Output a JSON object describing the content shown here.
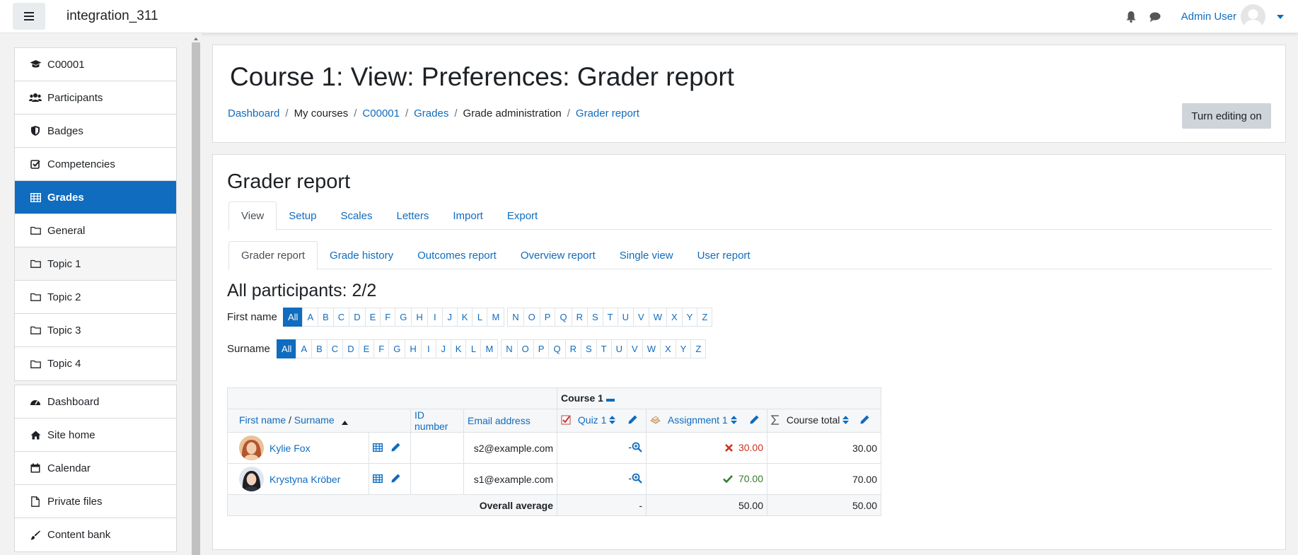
{
  "navbar": {
    "site_name": "integration_311",
    "user_name": "Admin User",
    "icons": [
      "menu-icon",
      "bell-icon",
      "comment-icon",
      "avatar-icon",
      "caret-down-icon"
    ]
  },
  "drawer": {
    "course_items": [
      {
        "label": "C00001",
        "icon": "graduation-cap-icon"
      },
      {
        "label": "Participants",
        "icon": "users-icon"
      },
      {
        "label": "Badges",
        "icon": "shield-icon"
      },
      {
        "label": "Competencies",
        "icon": "check-square-icon"
      },
      {
        "label": "Grades",
        "icon": "table-icon",
        "active": true
      },
      {
        "label": "General",
        "icon": "folder-icon"
      },
      {
        "label": "Topic 1",
        "icon": "folder-icon"
      },
      {
        "label": "Topic 2",
        "icon": "folder-icon"
      },
      {
        "label": "Topic 3",
        "icon": "folder-icon"
      },
      {
        "label": "Topic 4",
        "icon": "folder-icon"
      }
    ],
    "site_items": [
      {
        "label": "Dashboard",
        "icon": "tachometer-icon"
      },
      {
        "label": "Site home",
        "icon": "home-icon"
      },
      {
        "label": "Calendar",
        "icon": "calendar-icon"
      },
      {
        "label": "Private files",
        "icon": "file-icon"
      },
      {
        "label": "Content bank",
        "icon": "paint-brush-icon"
      }
    ]
  },
  "header": {
    "title": "Course 1: View: Preferences: Grader report",
    "breadcrumb": [
      "Dashboard",
      "My courses",
      "C00001",
      "Grades",
      "Grade administration",
      "Grader report"
    ],
    "edit_button": "Turn editing on"
  },
  "main": {
    "title": "Grader report",
    "tabs": [
      "View",
      "Setup",
      "Scales",
      "Letters",
      "Import",
      "Export"
    ],
    "subtabs": [
      "Grader report",
      "Grade history",
      "Outcomes report",
      "Overview report",
      "Single view",
      "User report"
    ],
    "participants_title": "All participants: 2/2",
    "first_name_label": "First name",
    "surname_label": "Surname",
    "all_label": "All",
    "letters": [
      "A",
      "B",
      "C",
      "D",
      "E",
      "F",
      "G",
      "H",
      "I",
      "J",
      "K",
      "L",
      "M",
      "N",
      "O",
      "P",
      "Q",
      "R",
      "S",
      "T",
      "U",
      "V",
      "W",
      "X",
      "Y",
      "Z"
    ]
  },
  "grader": {
    "category": "Course 1",
    "headers": {
      "first_name": "First name",
      "surname": "Surname",
      "id_number": "ID number",
      "email": "Email address",
      "quiz": "Quiz 1",
      "assignment": "Assignment 1",
      "course_total": "Course total"
    },
    "rows": [
      {
        "name": "Kylie Fox",
        "email": "s2@example.com",
        "quiz": "-",
        "assignment": "30.00",
        "status": "fail",
        "total": "30.00"
      },
      {
        "name": "Krystyna Kröber",
        "email": "s1@example.com",
        "quiz": "-",
        "assignment": "70.00",
        "status": "pass",
        "total": "70.00"
      }
    ],
    "average": {
      "label": "Overall average",
      "quiz": "-",
      "assignment": "50.00",
      "total": "50.00"
    }
  },
  "colors": {
    "accent": "#0f6cbf",
    "fail": "#ca3120",
    "pass": "#357a32"
  }
}
